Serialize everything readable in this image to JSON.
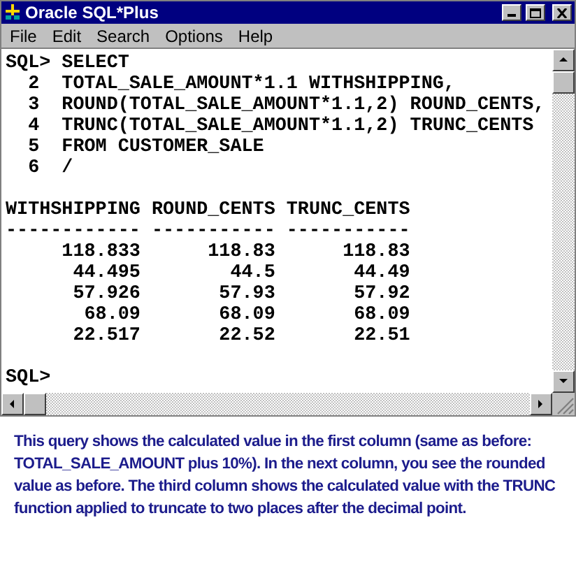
{
  "window": {
    "title": "Oracle SQL*Plus"
  },
  "menu": [
    {
      "label": "File"
    },
    {
      "label": "Edit"
    },
    {
      "label": "Search"
    },
    {
      "label": "Options"
    },
    {
      "label": "Help"
    }
  ],
  "console": {
    "lines": [
      {
        "kind": "line",
        "text": "SQL> SELECT"
      },
      {
        "kind": "line",
        "text": "  2  TOTAL_SALE_AMOUNT*1.1 WITHSHIPPING,"
      },
      {
        "kind": "line",
        "text": "  3  ROUND(TOTAL_SALE_AMOUNT*1.1,2) ROUND_CENTS,"
      },
      {
        "kind": "line",
        "text": "  4  TRUNC(TOTAL_SALE_AMOUNT*1.1,2) TRUNC_CENTS"
      },
      {
        "kind": "line",
        "text": "  5  FROM CUSTOMER_SALE"
      },
      {
        "kind": "line",
        "text": "  6  /"
      },
      {
        "kind": "blank"
      },
      {
        "kind": "line",
        "text": "WITHSHIPPING ROUND_CENTS TRUNC_CENTS"
      },
      {
        "kind": "line",
        "text": "------------ ----------- -----------"
      },
      {
        "kind": "line",
        "text": "     118.833      118.83      118.83"
      },
      {
        "kind": "line",
        "text": "      44.495        44.5       44.49"
      },
      {
        "kind": "line",
        "text": "      57.926       57.93       57.92"
      },
      {
        "kind": "line",
        "text": "       68.09       68.09       68.09"
      },
      {
        "kind": "line",
        "text": "      22.517       22.52       22.51"
      },
      {
        "kind": "blank"
      },
      {
        "kind": "line",
        "text": "SQL>"
      }
    ]
  },
  "caption": "This query shows the calculated value in the first column (same as before: TOTAL_SALE_AMOUNT plus 10%). In the next column, you see the rounded value as before. The third column shows the calculated value with the TRUNC function applied to truncate to two places after the decimal point."
}
